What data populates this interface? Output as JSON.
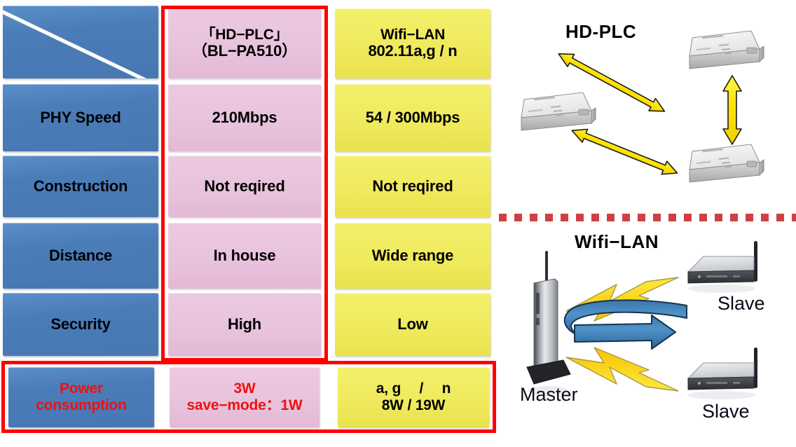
{
  "table": {
    "columns": [
      {
        "key": "feature",
        "label": ""
      },
      {
        "key": "hdplc",
        "label_line1": "「HD−PLC」",
        "label_line2": "（BL−PA510）"
      },
      {
        "key": "wifi",
        "label_line1": "Wifi−LAN",
        "label_line2": "802.11a,g / n"
      }
    ],
    "rows": [
      {
        "feature": "PHY Speed",
        "hdplc_line1": "210Mbps",
        "hdplc_line2": "",
        "wifi_line1": "54 / 300Mbps",
        "wifi_line2": ""
      },
      {
        "feature": "Construction",
        "hdplc_line1": "Not reqired",
        "hdplc_line2": "",
        "wifi_line1": "Not reqired",
        "wifi_line2": ""
      },
      {
        "feature": "Distance",
        "hdplc_line1": "In house",
        "hdplc_line2": "",
        "wifi_line1": "Wide range",
        "wifi_line2": ""
      },
      {
        "feature": "Security",
        "hdplc_line1": "High",
        "hdplc_line2": "",
        "wifi_line1": "Low",
        "wifi_line2": ""
      }
    ],
    "power_row": {
      "feature_line1": "Power",
      "feature_line2": "consumption",
      "hdplc_line1": "3W",
      "hdplc_line2": "save−mode：1W",
      "wifi_line1": "a, g 　/　 n",
      "wifi_line2": "8W / 19W"
    }
  },
  "diagram": {
    "hdplc": {
      "title": "HD-PLC",
      "devices": [
        "plc-adapter",
        "plc-adapter",
        "plc-adapter"
      ]
    },
    "wifi": {
      "title": "Wifi−LAN",
      "master_label": "Master",
      "slave_top_label": "Slave",
      "slave_bottom_label": "Slave"
    }
  },
  "colors": {
    "blue_cell": "#4a7cb8",
    "pink_cell": "#e8c2dc",
    "yellow_cell": "#efe95c",
    "highlight_red": "#ff0000",
    "separator_red": "#d04040",
    "power_text_red": "#ee1111",
    "arrow_yellow": "#ffe400",
    "arrow_blue": "#2f6ca8"
  }
}
